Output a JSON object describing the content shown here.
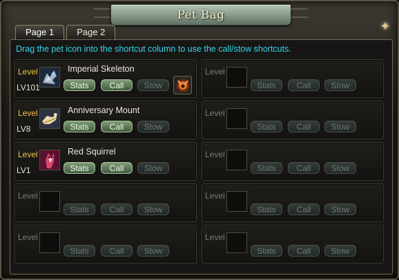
{
  "window": {
    "title": "Pet Bag",
    "close_icon": "close-star-icon"
  },
  "tabs": [
    {
      "label": "Page 1",
      "active": true
    },
    {
      "label": "Page 2",
      "active": false
    }
  ],
  "instruction": "Drag the pet icon into the shortcut column to use the call/stow shortcuts.",
  "slots": [
    {
      "level_label": "Level",
      "level_value": "LV101",
      "name": "Imperial Skeleton",
      "icon": "imperial-skeleton-pet-icon",
      "has_shortcut": true,
      "buttons": {
        "stats": "Stats",
        "call": "Call",
        "stow": "Stow"
      }
    },
    {
      "level_label": "Level",
      "level_value": "",
      "name": "",
      "buttons": {
        "stats": "Stats",
        "call": "Call",
        "stow": "Stow"
      }
    },
    {
      "level_label": "Level",
      "level_value": "LV8",
      "name": "Anniversary Mount",
      "icon": "anniversary-mount-pet-icon",
      "buttons": {
        "stats": "Stats",
        "call": "Call",
        "stow": "Stow"
      }
    },
    {
      "level_label": "Level",
      "level_value": "",
      "name": "",
      "buttons": {
        "stats": "Stats",
        "call": "Call",
        "stow": "Stow"
      }
    },
    {
      "level_label": "Level",
      "level_value": "LV1",
      "name": "Red Squirrel",
      "icon": "red-squirrel-pet-icon",
      "buttons": {
        "stats": "Stats",
        "call": "Call",
        "stow": "Stow"
      }
    },
    {
      "level_label": "Level",
      "level_value": "",
      "name": "",
      "buttons": {
        "stats": "Stats",
        "call": "Call",
        "stow": "Stow"
      }
    },
    {
      "level_label": "Level",
      "level_value": "",
      "name": "",
      "buttons": {
        "stats": "Stats",
        "call": "Call",
        "stow": "Stow"
      }
    },
    {
      "level_label": "Level",
      "level_value": "",
      "name": "",
      "buttons": {
        "stats": "Stats",
        "call": "Call",
        "stow": "Stow"
      }
    },
    {
      "level_label": "Level",
      "level_value": "",
      "name": "",
      "buttons": {
        "stats": "Stats",
        "call": "Call",
        "stow": "Stow"
      }
    },
    {
      "level_label": "Level",
      "level_value": "",
      "name": "",
      "buttons": {
        "stats": "Stats",
        "call": "Call",
        "stow": "Stow"
      }
    }
  ],
  "colors": {
    "instruction": "#39d3ea",
    "level_active": "#eec24a",
    "button_active": "#5f7c5a",
    "button_disabled": "#2c322f"
  }
}
